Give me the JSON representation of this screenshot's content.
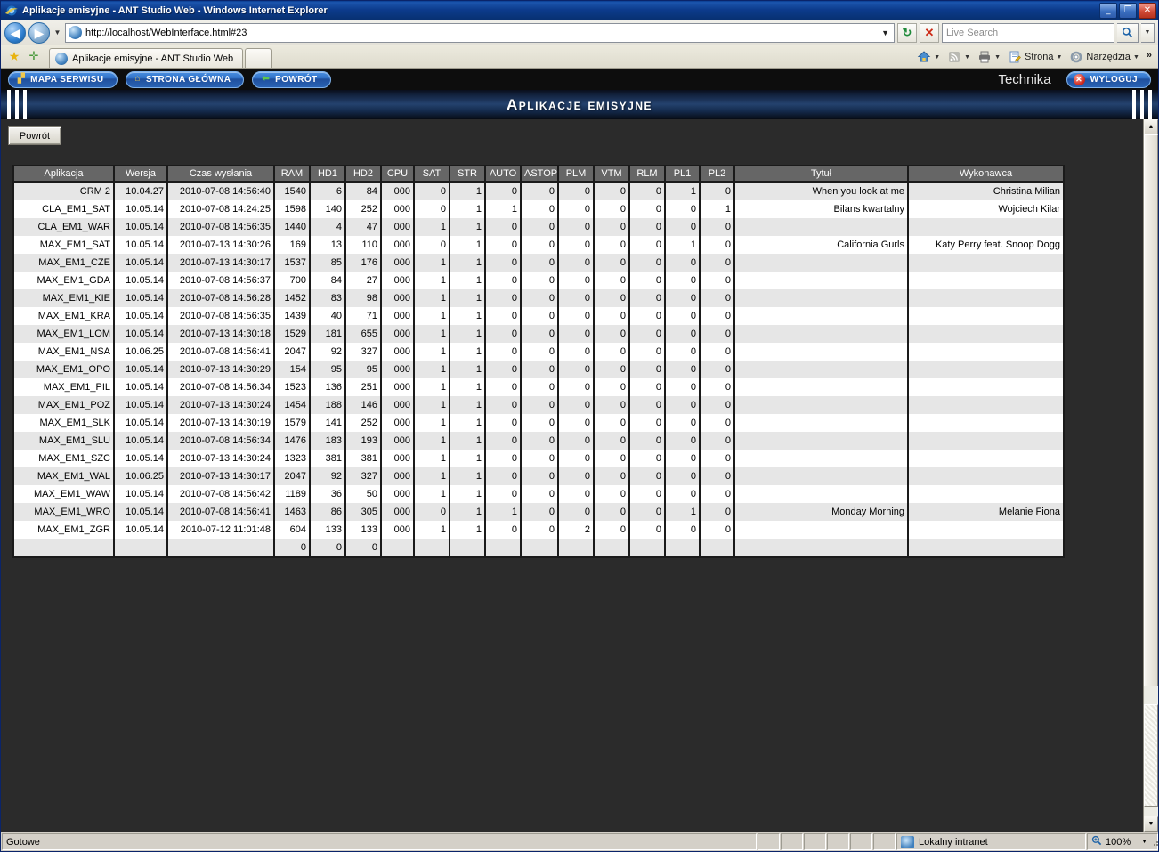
{
  "window": {
    "title": "Aplikacje emisyjne - ANT Studio Web - Windows Internet Explorer",
    "minimize": "_",
    "maximize": "❐",
    "close": "✕"
  },
  "browser": {
    "back_icon": "◀",
    "forward_icon": "▶",
    "history_caret": "▼",
    "url": "http://localhost/WebInterface.html#23",
    "url_dropdown_caret": "▼",
    "refresh_icon": "↻",
    "stop_icon": "✕",
    "search_placeholder": "Live Search",
    "search_go_icon": "🔍",
    "search_dropdown_caret": "▼",
    "favorites_star_icon": "★",
    "add_favorite_icon": "✛",
    "tab_label": "Aplikacje emisyjne - ANT Studio Web",
    "new_tab_label": "",
    "commands": {
      "home": "",
      "feeds": "",
      "print": "",
      "page": "Strona",
      "tools": "Narzędzia",
      "overflow": "»"
    }
  },
  "app": {
    "nav": [
      {
        "label": "MAPA SERWISU",
        "icon": "▞"
      },
      {
        "label": "STRONA GŁÓWNA",
        "icon": "⌂"
      },
      {
        "label": "POWRÓT",
        "icon": "⬅"
      }
    ],
    "tech_label": "Technika",
    "logout_label": "WYLOGUJ",
    "logout_icon": "✕",
    "banner_title": "Aplikacje emisyjne",
    "back_button": "Powrót"
  },
  "table": {
    "columns": [
      "Aplikacja",
      "Wersja",
      "Czas wysłania",
      "RAM",
      "HD1",
      "HD2",
      "CPU",
      "SAT",
      "STR",
      "AUTO",
      "ASTOP",
      "PLM",
      "VTM",
      "RLM",
      "PL1",
      "PL2",
      "Tytuł",
      "Wykonawca"
    ],
    "rows": [
      [
        "CRM 2",
        "10.04.27",
        "2010-07-08 14:56:40",
        "1540",
        "6",
        "84",
        "000",
        "0",
        "1",
        "0",
        "0",
        "0",
        "0",
        "0",
        "1",
        "0",
        "When you look at me",
        "Christina Milian"
      ],
      [
        "CLA_EM1_SAT",
        "10.05.14",
        "2010-07-08 14:24:25",
        "1598",
        "140",
        "252",
        "000",
        "0",
        "1",
        "1",
        "0",
        "0",
        "0",
        "0",
        "0",
        "1",
        "Bilans kwartalny",
        "Wojciech Kilar"
      ],
      [
        "CLA_EM1_WAR",
        "10.05.14",
        "2010-07-08 14:56:35",
        "1440",
        "4",
        "47",
        "000",
        "1",
        "1",
        "0",
        "0",
        "0",
        "0",
        "0",
        "0",
        "0",
        "",
        ""
      ],
      [
        "MAX_EM1_SAT",
        "10.05.14",
        "2010-07-13 14:30:26",
        "169",
        "13",
        "110",
        "000",
        "0",
        "1",
        "0",
        "0",
        "0",
        "0",
        "0",
        "1",
        "0",
        "California Gurls",
        "Katy Perry feat. Snoop Dogg"
      ],
      [
        "MAX_EM1_CZE",
        "10.05.14",
        "2010-07-13 14:30:17",
        "1537",
        "85",
        "176",
        "000",
        "1",
        "1",
        "0",
        "0",
        "0",
        "0",
        "0",
        "0",
        "0",
        "",
        ""
      ],
      [
        "MAX_EM1_GDA",
        "10.05.14",
        "2010-07-08 14:56:37",
        "700",
        "84",
        "27",
        "000",
        "1",
        "1",
        "0",
        "0",
        "0",
        "0",
        "0",
        "0",
        "0",
        "",
        ""
      ],
      [
        "MAX_EM1_KIE",
        "10.05.14",
        "2010-07-08 14:56:28",
        "1452",
        "83",
        "98",
        "000",
        "1",
        "1",
        "0",
        "0",
        "0",
        "0",
        "0",
        "0",
        "0",
        "",
        ""
      ],
      [
        "MAX_EM1_KRA",
        "10.05.14",
        "2010-07-08 14:56:35",
        "1439",
        "40",
        "71",
        "000",
        "1",
        "1",
        "0",
        "0",
        "0",
        "0",
        "0",
        "0",
        "0",
        "",
        ""
      ],
      [
        "MAX_EM1_LOM",
        "10.05.14",
        "2010-07-13 14:30:18",
        "1529",
        "181",
        "655",
        "000",
        "1",
        "1",
        "0",
        "0",
        "0",
        "0",
        "0",
        "0",
        "0",
        "",
        ""
      ],
      [
        "MAX_EM1_NSA",
        "10.06.25",
        "2010-07-08 14:56:41",
        "2047",
        "92",
        "327",
        "000",
        "1",
        "1",
        "0",
        "0",
        "0",
        "0",
        "0",
        "0",
        "0",
        "",
        ""
      ],
      [
        "MAX_EM1_OPO",
        "10.05.14",
        "2010-07-13 14:30:29",
        "154",
        "95",
        "95",
        "000",
        "1",
        "1",
        "0",
        "0",
        "0",
        "0",
        "0",
        "0",
        "0",
        "",
        ""
      ],
      [
        "MAX_EM1_PIL",
        "10.05.14",
        "2010-07-08 14:56:34",
        "1523",
        "136",
        "251",
        "000",
        "1",
        "1",
        "0",
        "0",
        "0",
        "0",
        "0",
        "0",
        "0",
        "",
        ""
      ],
      [
        "MAX_EM1_POZ",
        "10.05.14",
        "2010-07-13 14:30:24",
        "1454",
        "188",
        "146",
        "000",
        "1",
        "1",
        "0",
        "0",
        "0",
        "0",
        "0",
        "0",
        "0",
        "",
        ""
      ],
      [
        "MAX_EM1_SLK",
        "10.05.14",
        "2010-07-13 14:30:19",
        "1579",
        "141",
        "252",
        "000",
        "1",
        "1",
        "0",
        "0",
        "0",
        "0",
        "0",
        "0",
        "0",
        "",
        ""
      ],
      [
        "MAX_EM1_SLU",
        "10.05.14",
        "2010-07-08 14:56:34",
        "1476",
        "183",
        "193",
        "000",
        "1",
        "1",
        "0",
        "0",
        "0",
        "0",
        "0",
        "0",
        "0",
        "",
        ""
      ],
      [
        "MAX_EM1_SZC",
        "10.05.14",
        "2010-07-13 14:30:24",
        "1323",
        "381",
        "381",
        "000",
        "1",
        "1",
        "0",
        "0",
        "0",
        "0",
        "0",
        "0",
        "0",
        "",
        ""
      ],
      [
        "MAX_EM1_WAL",
        "10.06.25",
        "2010-07-13 14:30:17",
        "2047",
        "92",
        "327",
        "000",
        "1",
        "1",
        "0",
        "0",
        "0",
        "0",
        "0",
        "0",
        "0",
        "",
        ""
      ],
      [
        "MAX_EM1_WAW",
        "10.05.14",
        "2010-07-08 14:56:42",
        "1189",
        "36",
        "50",
        "000",
        "1",
        "1",
        "0",
        "0",
        "0",
        "0",
        "0",
        "0",
        "0",
        "",
        ""
      ],
      [
        "MAX_EM1_WRO",
        "10.05.14",
        "2010-07-08 14:56:41",
        "1463",
        "86",
        "305",
        "000",
        "0",
        "1",
        "1",
        "0",
        "0",
        "0",
        "0",
        "1",
        "0",
        "Monday Morning",
        "Melanie Fiona"
      ],
      [
        "MAX_EM1_ZGR",
        "10.05.14",
        "2010-07-12 11:01:48",
        "604",
        "133",
        "133",
        "000",
        "1",
        "1",
        "0",
        "0",
        "2",
        "0",
        "0",
        "0",
        "0",
        "",
        ""
      ],
      [
        "",
        "",
        "",
        "0",
        "0",
        "0",
        "",
        "",
        "",
        "",
        "",
        "",
        "",
        "",
        "",
        "",
        "",
        ""
      ]
    ]
  },
  "scrollbar": {
    "up_icon": "▲",
    "down_icon": "▼"
  },
  "status": {
    "message": "Gotowe",
    "zone": "Lokalny intranet",
    "zoom": "100%",
    "zoom_caret": "▼",
    "zoom_icon": "🔍"
  }
}
